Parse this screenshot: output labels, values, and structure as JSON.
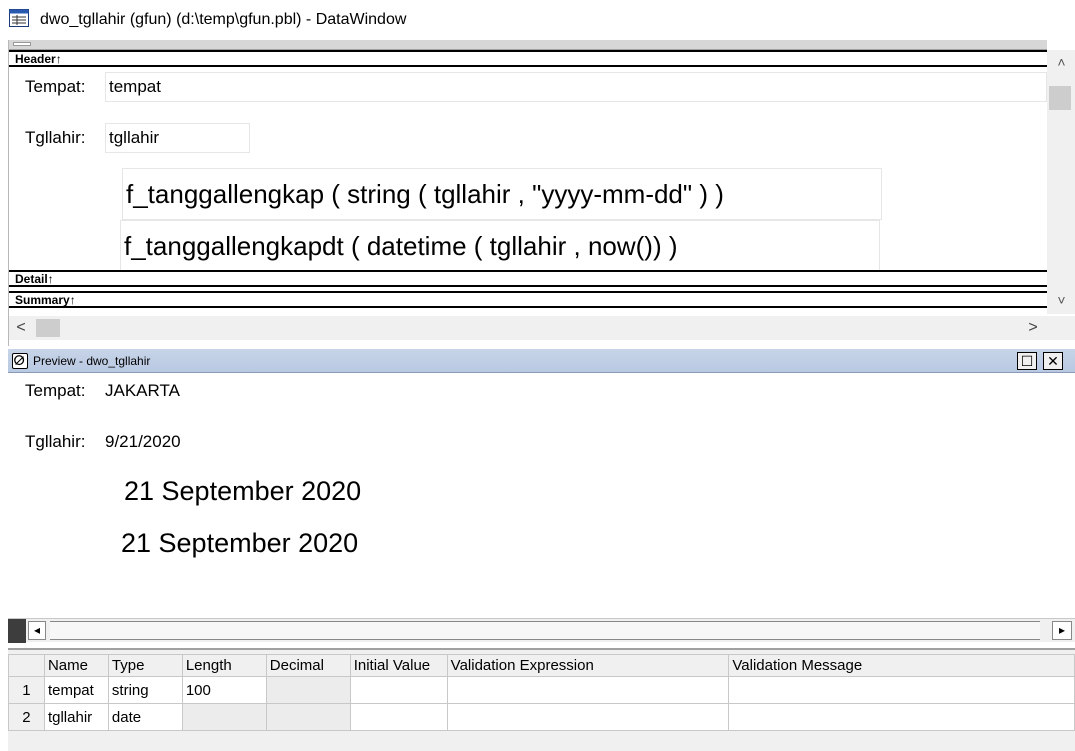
{
  "window": {
    "title": "dwo_tgllahir  (gfun) (d:\\temp\\gfun.pbl) - DataWindow",
    "icon": "datawindow-icon"
  },
  "design": {
    "bands": {
      "header": "Header↑",
      "detail": "Detail↑",
      "summary": "Summary↑"
    },
    "tempat_label": "Tempat:",
    "tempat_field": "tempat",
    "tgllahir_label": "Tgllahir:",
    "tgllahir_field": "tgllahir",
    "expr1": "f_tanggallengkap (  string ( tgllahir , \"yyyy-mm-dd\" ) )",
    "expr2": "f_tanggallengkapdt (  datetime ( tgllahir , now()) )",
    "scroll_up": "˄",
    "scroll_down": "˅",
    "scroll_left": "<",
    "scroll_right": ">"
  },
  "preview": {
    "title": "Preview - dwo_tgllahir",
    "restore_btn": "☐",
    "close_btn": "✕",
    "tempat_label": "Tempat:",
    "tempat_value": "JAKARTA",
    "tgllahir_label": "Tgllahir:",
    "tgllahir_value": "9/21/2020",
    "result1": "21 September 2020",
    "result2": "21 September 2020",
    "scroll_left": "◂",
    "scroll_right": "▸"
  },
  "columns": {
    "headers": [
      "Name",
      "Type",
      "Length",
      "Decimal",
      "Initial Value",
      "Validation Expression",
      "Validation Message"
    ],
    "rows": [
      {
        "num": "1",
        "name": "tempat",
        "type": "string",
        "length": "100",
        "decimal": "",
        "initial": "",
        "valexpr": "",
        "valmsg": ""
      },
      {
        "num": "2",
        "name": "tgllahir",
        "type": "date",
        "length": "",
        "decimal": "",
        "initial": "",
        "valexpr": "",
        "valmsg": ""
      }
    ]
  }
}
